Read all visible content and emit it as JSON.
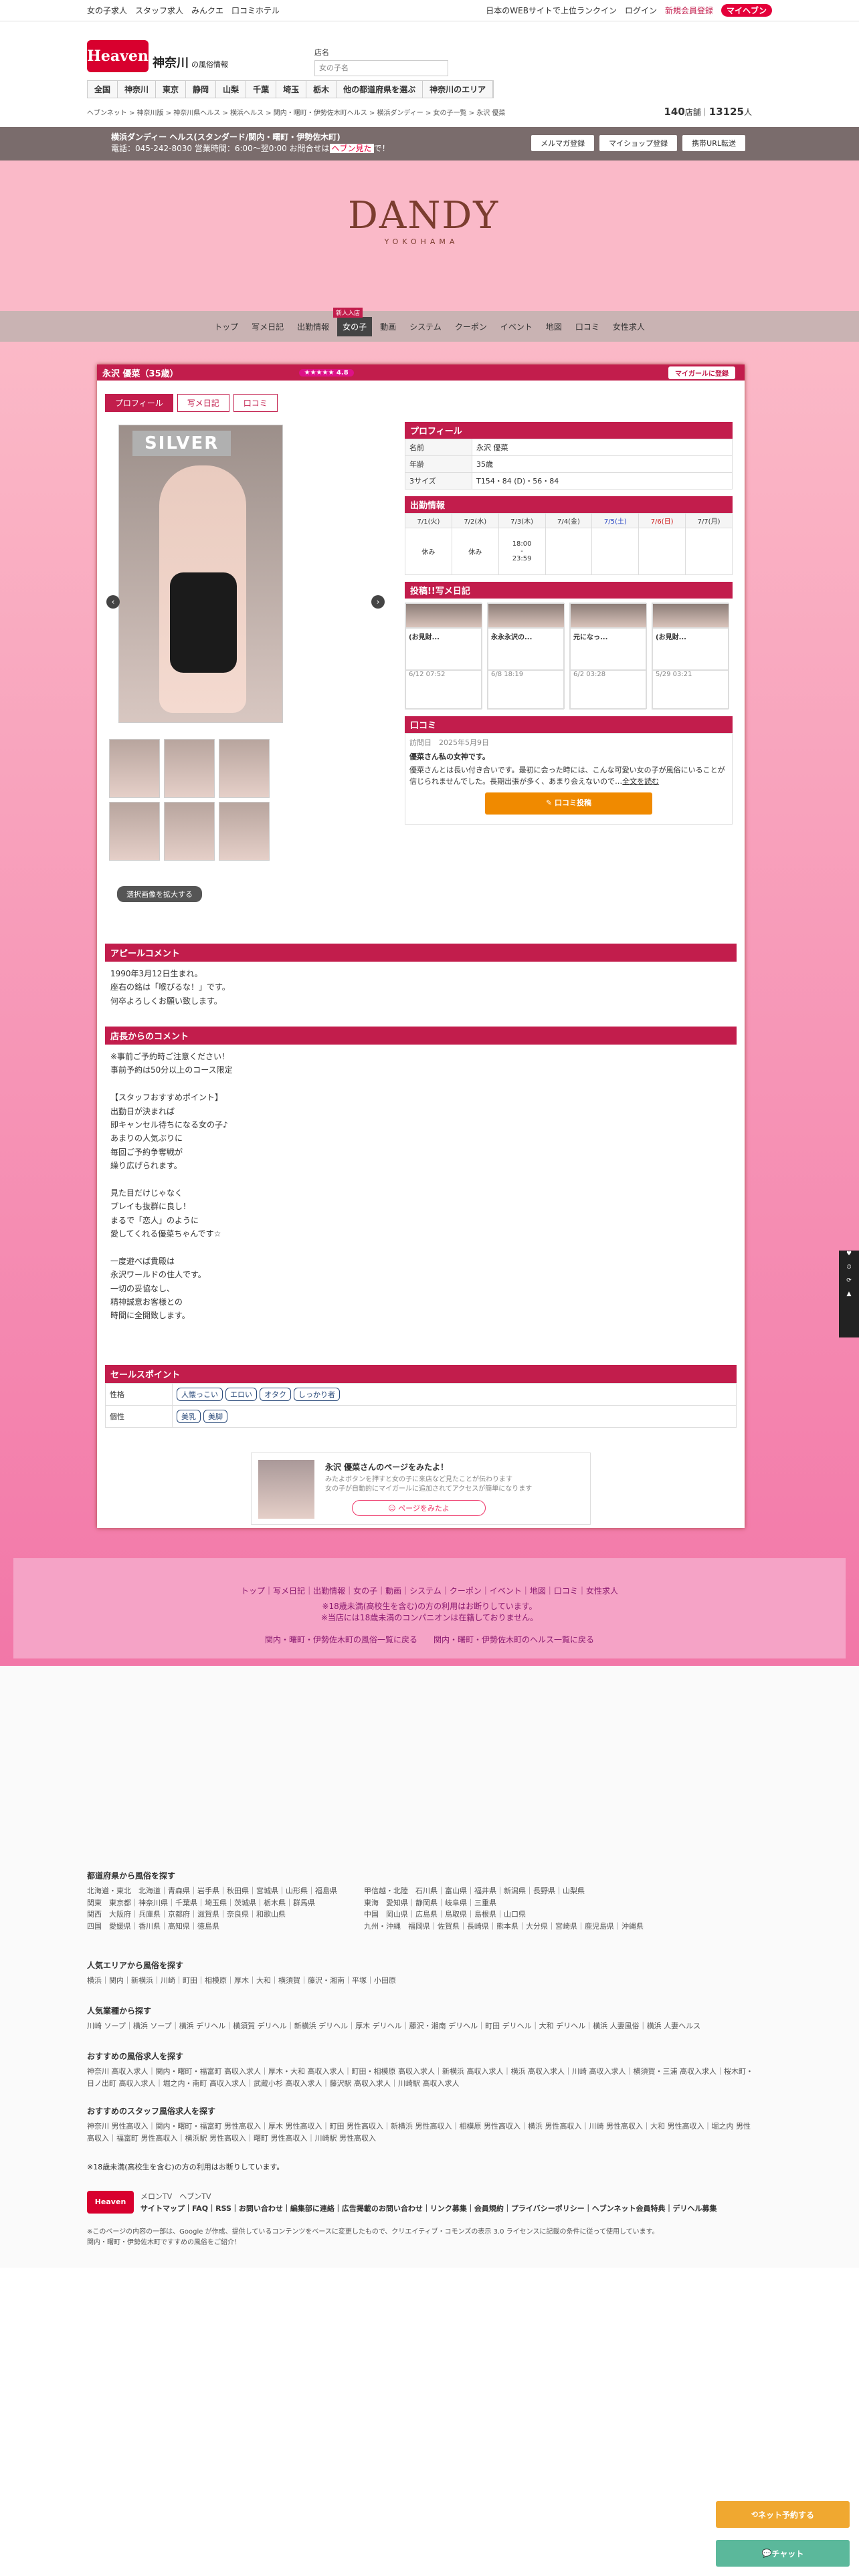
{
  "topline": {
    "links": [
      "女の子求人",
      "スタッフ求人",
      "みんクエ",
      "口コミホテル"
    ],
    "right": [
      "日本のWEBサイトで上位ランクイン",
      "ログイン",
      "新規会員登録"
    ],
    "my": "マイヘブン"
  },
  "header": {
    "logo": "Heaven",
    "region": "神奈川",
    "region_sub": "の風俗情報",
    "search_label": "店名",
    "search_placeholder": "女の子名"
  },
  "nav": [
    "全国",
    "神奈川",
    "東京",
    "静岡",
    "山梨",
    "千葉",
    "埼玉",
    "栃木",
    "他の都道府県を選ぶ",
    "神奈川のエリア"
  ],
  "crumb": "ヘブンネット > 神奈川版 > 神奈川県ヘルス > 横浜ヘルス > 関内・曙町・伊勢佐木町ヘルス > 横浜ダンディー > 女の子一覧 > 永沢 優菜",
  "counts": {
    "shops": "140",
    "shops_unit": "店舗",
    "girls": "13125",
    "girls_unit": "人"
  },
  "shop": {
    "name": "横浜ダンディー ヘルス(スタンダード/関内・曙町・伊勢佐木町)",
    "info": "電話：045-242-8030 営業時間：6:00～翌0:00 お問合せは",
    "info_em": "ヘブン見た",
    "info_tail": "で！",
    "buttons": [
      "メルマガ登録",
      "マイショップ登録",
      "携帯URL転送"
    ]
  },
  "shoplogo": {
    "name": "DANDY",
    "sub": "YOKOHAMA"
  },
  "shopnav": [
    "トップ",
    "写メ日記",
    "出勤情報",
    "女の子",
    "動画",
    "システム",
    "クーポン",
    "イベント",
    "地図",
    "口コミ",
    "女性求人"
  ],
  "newbadge": "新人入店",
  "girl": {
    "title": "永沢 優菜（35歳）",
    "stars": "★★★★★ 4.8",
    "mygirl": "マイガールに登録",
    "tabs": [
      "プロフィール",
      "写メ日記",
      "口コミ"
    ],
    "rank": "SILVER",
    "select_btn": "選択画像を拡大する"
  },
  "profile": {
    "head": "プロフィール",
    "rows": [
      [
        "名前",
        "永沢 優菜"
      ],
      [
        "年齢",
        "35歳"
      ],
      [
        "3サイズ",
        "T154・84 (D)・56・84"
      ]
    ]
  },
  "schedule": {
    "head": "出勤情報",
    "days": [
      "7/1(火)",
      "7/2(水)",
      "7/3(木)",
      "7/4(金)",
      "7/5(土)",
      "7/6(日)",
      "7/7(月)"
    ],
    "times": [
      "休み",
      "休み",
      "18:00\n-\n23:59",
      "",
      "",
      "",
      ""
    ]
  },
  "diary": {
    "head": "投稿!!写メ日記",
    "posts": [
      {
        "t": "(お見財...",
        "d": "6/12 07:52"
      },
      {
        "t": "永永永沢の...",
        "d": "6/8 18:19"
      },
      {
        "t": "元になっ...",
        "d": "6/2 03:28"
      },
      {
        "t": "(お見財...",
        "d": "5/29 03:21"
      }
    ]
  },
  "review": {
    "head": "口コミ",
    "date": "訪問日　2025年5月9日",
    "title": "優菜さん私の女神です。",
    "body": "優菜さんとは長い付き合いです。最初に会った時には、こんな可愛い女の子が風俗にいることが信じられませんでした。長期出張が多く、あまり会えないので…",
    "more": "全文を読む",
    "btn": "口コミ投稿"
  },
  "appeal": {
    "head": "アピールコメント",
    "body": "1990年3月12日生まれ。\n座右の銘は「喉ぴるな！」です。\n何卒よろしくお願い致します。"
  },
  "shopcomment": {
    "head": "店長からのコメント",
    "body": "※事前ご予約時ご注意ください！\n事前予約は50分以上のコース限定\n\n【スタッフおすすめポイント】\n出勤日が決まれば\n即キャンセル待ちになる女の子♪\nあまりの人気ぶりに\n毎回ご予約争奪戦が\n繰り広げられます。\n\n見た目だけじゃなく\nプレイも抜群に良し！\nまるで「恋人」のように\n愛してくれる優菜ちゃんです☆\n\n一度遊べば貴殿は\n永沢ワールドの住人です。\n一切の妥協なし、\n精神誠意お客様との\n時間に全開致します。"
  },
  "sales": {
    "head": "セールスポイント",
    "rows": [
      {
        "k": "性格",
        "tags": [
          "人懐っこい",
          "エロい",
          "オタク",
          "しっかり者"
        ]
      },
      {
        "k": "個性",
        "tags": [
          "美乳",
          "美脚"
        ]
      }
    ]
  },
  "mypage": {
    "title": "永沢 優菜さんのページをみたよ！",
    "l1": "みたよボタンを押すと女の子に来店など見たことが伝わります",
    "l2": "女の子が自動的にマイガールに追加されてアクセスが簡単になります",
    "btn": "ページをみたよ"
  },
  "footnav": {
    "links": [
      "トップ",
      "写メ日記",
      "出勤情報",
      "女の子",
      "動画",
      "システム",
      "クーポン",
      "イベント",
      "地図",
      "口コミ",
      "女性求人"
    ],
    "n1": "※18歳未満(高校生を含む)の方の利用はお断りしています。",
    "n2": "※当店には18歳未満のコンパニオンは在籍しておりません。",
    "b1": "関内・曙町・伊勢佐木町の風俗一覧に戻る",
    "b2": "関内・曙町・伊勢佐木町のヘルス一覧に戻る"
  },
  "footer": {
    "pref_head": "都道府県から風俗を探す",
    "pref_left": [
      "北海道・東北　北海道｜青森県｜岩手県｜秋田県｜宮城県｜山形県｜福島県",
      "関東　東京都｜神奈川県｜千葉県｜埼玉県｜茨城県｜栃木県｜群馬県",
      "関西　大阪府｜兵庫県｜京都府｜滋賀県｜奈良県｜和歌山県",
      "四国　愛媛県｜香川県｜高知県｜徳島県"
    ],
    "pref_right": [
      "甲信越・北陸　石川県｜富山県｜福井県｜新潟県｜長野県｜山梨県",
      "東海　愛知県｜静岡県｜岐阜県｜三重県",
      "中国　岡山県｜広島県｜鳥取県｜島根県｜山口県",
      "九州・沖縄　福岡県｜佐賀県｜長崎県｜熊本県｜大分県｜宮崎県｜鹿児島県｜沖縄県"
    ],
    "area_head": "人気エリアから風俗を探す",
    "area": "横浜｜関内｜新横浜｜川崎｜町田｜相模原｜厚木｜大和｜横須賀｜藤沢・湘南｜平塚｜小田原",
    "genre_head": "人気業種から探す",
    "genre": "川崎 ソープ｜横浜 ソープ｜横浜 デリヘル｜横須賀 デリヘル｜新横浜 デリヘル｜厚木 デリヘル｜藤沢・湘南 デリヘル｜町田 デリヘル｜大和 デリヘル｜横浜 人妻風俗｜横浜 人妻ヘルス",
    "job_head": "おすすめの風俗求人を探す",
    "job": "神奈川 高収入求人｜関内・曙町・福富町 高収入求人｜厚木・大和 高収入求人｜町田・相模原 高収入求人｜新横浜 高収入求人｜横浜 高収入求人｜川崎 高収入求人｜横須賀・三浦 高収入求人｜桜木町・日ノ出町 高収入求人｜堀之内・南町 高収入求人｜武蔵小杉 高収入求人｜藤沢駅 高収入求人｜川崎駅 高収入求人",
    "staff_head": "おすすめのスタッフ風俗求人を探す",
    "staff": "神奈川 男性高収入｜関内・曙町・福富町 男性高収入｜厚木 男性高収入｜町田 男性高収入｜新横浜 男性高収入｜相模原 男性高収入｜横浜 男性高収入｜川崎 男性高収入｜大和 男性高収入｜堀之内 男性高収入｜福富町 男性高収入｜横浜駅 男性高収入｜曙町 男性高収入｜川崎駅 男性高収入",
    "age_note": "※18歳未満(高校生を含む)の方の利用はお断りしています。",
    "links": "サイトマップ｜FAQ｜RSS｜お問い合わせ｜編集部に連絡｜広告掲載のお問い合わせ｜リンク募集｜会員規約｜プライバシーポリシー｜ヘブンネット会員特典｜デリヘル募集",
    "services": [
      "メロンTV",
      "ヘブンTV"
    ],
    "copy": "※このページの内容の一部は、Google が作成、提供しているコンテンツをベースに変更したもので、クリエイティブ・コモンズの表示 3.0 ライセンスに記載の条件に従って使用しています。",
    "copy2": "関内・曙町・伊勢佐木町ですすめの風俗をご紹介！"
  },
  "floats": {
    "job": "ネット予約する",
    "chat": "チャット"
  },
  "colors": {
    "accent": "#c21d4c",
    "pink": "#fab9c8"
  }
}
